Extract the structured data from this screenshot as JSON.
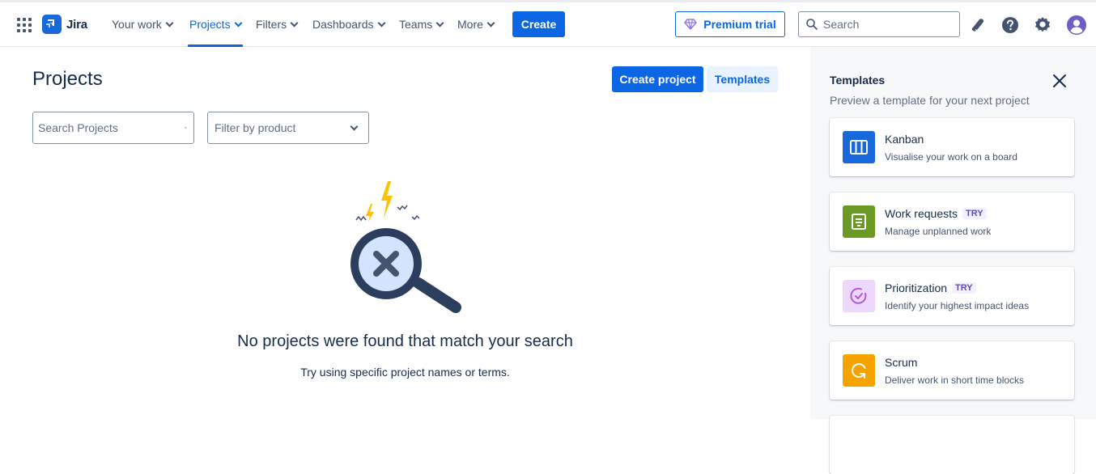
{
  "nav": {
    "logo_text": "Jira",
    "items": [
      {
        "label": "Your work"
      },
      {
        "label": "Projects"
      },
      {
        "label": "Filters"
      },
      {
        "label": "Dashboards"
      },
      {
        "label": "Teams"
      },
      {
        "label": "More"
      }
    ],
    "active": "Projects",
    "create_label": "Create",
    "premium_label": "Premium trial",
    "search_placeholder": "Search",
    "icons": [
      "app-switcher-icon",
      "notifications-icon",
      "help-icon",
      "settings-icon",
      "profile-avatar-icon"
    ]
  },
  "main": {
    "title": "Projects",
    "create_project_label": "Create project",
    "templates_label": "Templates",
    "search_placeholder": "Search Projects",
    "filter_placeholder": "Filter by product",
    "empty_title": "No projects were found that match your search",
    "empty_subtitle": "Try using specific project names or terms."
  },
  "panel": {
    "title": "Templates",
    "subtitle": "Preview a template for your next project",
    "templates": [
      {
        "name": "Kanban",
        "description": "Visualise your work on a board",
        "badge": "",
        "icon": "kanban-board-icon",
        "color": "#1868DB"
      },
      {
        "name": "Work requests",
        "description": "Manage unplanned work",
        "badge": "TRY",
        "icon": "form-document-icon",
        "color": "#6A9A23"
      },
      {
        "name": "Prioritization",
        "description": "Identify your highest impact ideas",
        "badge": "TRY",
        "icon": "check-circle-icon",
        "color": "#EED7FC"
      },
      {
        "name": "Scrum",
        "description": "Deliver work in short time blocks",
        "badge": "",
        "icon": "cycle-icon",
        "color": "#F5A300"
      }
    ]
  },
  "colors": {
    "brand": "#0C66E4",
    "text": "#172B4D",
    "panel_bg": "#F7F8F9"
  }
}
